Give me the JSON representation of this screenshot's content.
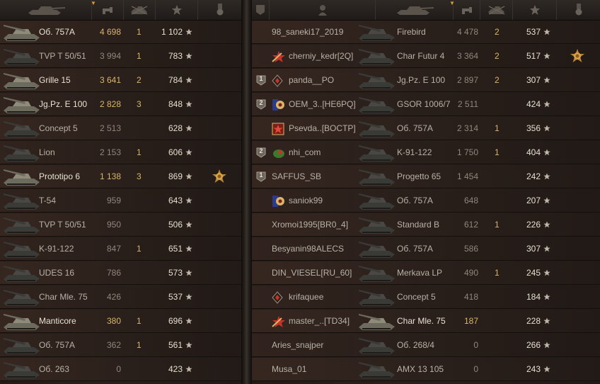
{
  "left": {
    "rows": [
      {
        "tank": "Об. 757А",
        "damage": "4 698",
        "kills": "1",
        "xp": "1 102",
        "alive": true,
        "hi": true,
        "medal": false
      },
      {
        "tank": "TVP T 50/51",
        "damage": "3 994",
        "kills": "1",
        "xp": "783",
        "alive": false,
        "hi": false,
        "medal": false
      },
      {
        "tank": "Grille 15",
        "damage": "3 641",
        "kills": "2",
        "xp": "784",
        "alive": true,
        "hi": true,
        "medal": false
      },
      {
        "tank": "Jg.Pz. E 100",
        "damage": "2 828",
        "kills": "3",
        "xp": "848",
        "alive": true,
        "hi": true,
        "medal": false
      },
      {
        "tank": "Concept 5",
        "damage": "2 513",
        "kills": "",
        "xp": "628",
        "alive": false,
        "hi": false,
        "medal": false
      },
      {
        "tank": "Lion",
        "damage": "2 153",
        "kills": "1",
        "xp": "606",
        "alive": false,
        "hi": false,
        "medal": false
      },
      {
        "tank": "Prototipo 6",
        "damage": "1 138",
        "kills": "3",
        "xp": "869",
        "alive": true,
        "hi": true,
        "medal": true
      },
      {
        "tank": "T-54",
        "damage": "959",
        "kills": "",
        "xp": "643",
        "alive": false,
        "hi": false,
        "medal": false
      },
      {
        "tank": "TVP T 50/51",
        "damage": "950",
        "kills": "",
        "xp": "506",
        "alive": false,
        "hi": false,
        "medal": false
      },
      {
        "tank": "K-91-122",
        "damage": "847",
        "kills": "1",
        "xp": "651",
        "alive": false,
        "hi": false,
        "medal": false
      },
      {
        "tank": "UDES 16",
        "damage": "786",
        "kills": "",
        "xp": "573",
        "alive": false,
        "hi": false,
        "medal": false
      },
      {
        "tank": "Char Mle. 75",
        "damage": "426",
        "kills": "",
        "xp": "537",
        "alive": false,
        "hi": false,
        "medal": false
      },
      {
        "tank": "Manticore",
        "damage": "380",
        "kills": "1",
        "xp": "696",
        "alive": true,
        "hi": true,
        "medal": false
      },
      {
        "tank": "Об. 757А",
        "damage": "362",
        "kills": "1",
        "xp": "561",
        "alive": false,
        "hi": false,
        "medal": false
      },
      {
        "tank": "Об. 263",
        "damage": "0",
        "kills": "",
        "xp": "423",
        "alive": false,
        "hi": false,
        "medal": false
      }
    ]
  },
  "right": {
    "rows": [
      {
        "platoon": "",
        "badge": "",
        "player": "98_saneki17_2019",
        "tank": "Firebird",
        "damage": "4 478",
        "kills": "2",
        "xp": "537",
        "alive": false,
        "hi": false,
        "medal": false
      },
      {
        "platoon": "",
        "badge": "red-star",
        "player": "cherniy_kedr[2Q]",
        "tank": "Char Futur 4",
        "damage": "3 364",
        "kills": "2",
        "xp": "517",
        "alive": false,
        "hi": false,
        "medal": true
      },
      {
        "platoon": "1",
        "badge": "diamond",
        "player": "panda__PO",
        "tank": "Jg.Pz. E 100",
        "damage": "2 897",
        "kills": "2",
        "xp": "307",
        "alive": false,
        "hi": false,
        "medal": false
      },
      {
        "platoon": "2",
        "badge": "flower",
        "player": "OEM_3..[HE6PQ]",
        "tank": "GSOR 1006/7",
        "damage": "2 511",
        "kills": "",
        "xp": "424",
        "alive": false,
        "hi": false,
        "medal": false
      },
      {
        "platoon": "",
        "badge": "red-star-box",
        "player": "Psevda..[BOCTP]",
        "tank": "Об. 757А",
        "damage": "2 314",
        "kills": "1",
        "xp": "356",
        "alive": false,
        "hi": false,
        "medal": false
      },
      {
        "platoon": "2",
        "badge": "green-dot",
        "player": "nhi_com",
        "tank": "K-91-122",
        "damage": "1 750",
        "kills": "1",
        "xp": "404",
        "alive": false,
        "hi": false,
        "medal": false
      },
      {
        "platoon": "1",
        "badge": "",
        "player": "SAFFUS_SB",
        "tank": "Progetto 65",
        "damage": "1 454",
        "kills": "",
        "xp": "242",
        "alive": false,
        "hi": false,
        "medal": false
      },
      {
        "platoon": "",
        "badge": "flower",
        "player": "saniok99",
        "tank": "Об. 757А",
        "damage": "648",
        "kills": "",
        "xp": "207",
        "alive": false,
        "hi": false,
        "medal": false
      },
      {
        "platoon": "",
        "badge": "",
        "player": "Xromoi1995[BR0_4]",
        "tank": "Standard B",
        "damage": "612",
        "kills": "1",
        "xp": "226",
        "alive": false,
        "hi": false,
        "medal": false
      },
      {
        "platoon": "",
        "badge": "",
        "player": "Besyanin98ALECS",
        "tank": "Об. 757А",
        "damage": "586",
        "kills": "",
        "xp": "307",
        "alive": false,
        "hi": false,
        "medal": false
      },
      {
        "platoon": "",
        "badge": "",
        "player": "DIN_VIESEL[RU_60]",
        "tank": "Merkava LP",
        "damage": "490",
        "kills": "1",
        "xp": "245",
        "alive": false,
        "hi": false,
        "medal": false
      },
      {
        "platoon": "",
        "badge": "diamond",
        "player": "krifaquee",
        "tank": "Concept 5",
        "damage": "418",
        "kills": "",
        "xp": "184",
        "alive": false,
        "hi": false,
        "medal": false
      },
      {
        "platoon": "",
        "badge": "red-star",
        "player": "master_..[TD34]",
        "tank": "Char Mle. 75",
        "damage": "187",
        "kills": "",
        "xp": "228",
        "alive": true,
        "hi": true,
        "medal": false
      },
      {
        "platoon": "",
        "badge": "",
        "player": "Aries_snajper",
        "tank": "Об. 268/4",
        "damage": "0",
        "kills": "",
        "xp": "266",
        "alive": false,
        "hi": false,
        "medal": false
      },
      {
        "platoon": "",
        "badge": "",
        "player": "Musa_01",
        "tank": "AMX 13 105",
        "damage": "0",
        "kills": "",
        "xp": "243",
        "alive": false,
        "hi": false,
        "medal": false
      }
    ]
  },
  "icons": {
    "header": [
      "tank-icon",
      "damage-icon",
      "kills-icon",
      "star-icon",
      "medal-icon",
      "platoon-icon",
      "player-icon"
    ],
    "xp_star": "star-icon"
  },
  "colors": {
    "highlight": "#d8b56a",
    "text": "#e6e0d2",
    "dim": "#8f877c"
  }
}
